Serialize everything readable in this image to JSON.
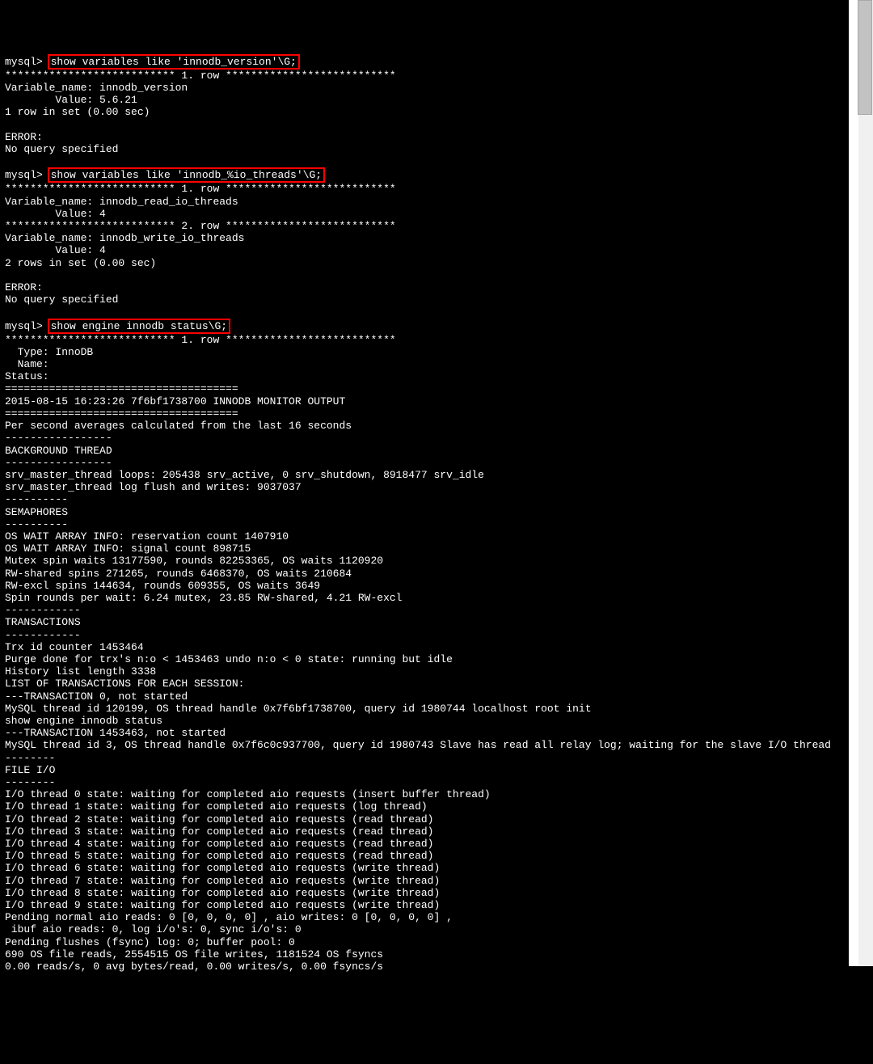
{
  "prompt": "mysql> ",
  "cmd1": "show variables like 'innodb_version'\\G;",
  "block1": "*************************** 1. row ***************************\nVariable_name: innodb_version\n        Value: 5.6.21\n1 row in set (0.00 sec)\n\nERROR:\nNo query specified\n",
  "cmd2": "show variables like 'innodb_%io_threads'\\G;",
  "block2": "*************************** 1. row ***************************\nVariable_name: innodb_read_io_threads\n        Value: 4\n*************************** 2. row ***************************\nVariable_name: innodb_write_io_threads\n        Value: 4\n2 rows in set (0.00 sec)\n\nERROR:\nNo query specified\n",
  "cmd3": "show engine innodb status\\G;",
  "block3": "*************************** 1. row ***************************\n  Type: InnoDB\n  Name:\nStatus:\n=====================================\n2015-08-15 16:23:26 7f6bf1738700 INNODB MONITOR OUTPUT\n=====================================\nPer second averages calculated from the last 16 seconds\n-----------------\nBACKGROUND THREAD\n-----------------\nsrv_master_thread loops: 205438 srv_active, 0 srv_shutdown, 8918477 srv_idle\nsrv_master_thread log flush and writes: 9037037\n----------\nSEMAPHORES\n----------\nOS WAIT ARRAY INFO: reservation count 1407910\nOS WAIT ARRAY INFO: signal count 898715\nMutex spin waits 13177590, rounds 82253365, OS waits 1120920\nRW-shared spins 271265, rounds 6468370, OS waits 210684\nRW-excl spins 144634, rounds 609355, OS waits 3649\nSpin rounds per wait: 6.24 mutex, 23.85 RW-shared, 4.21 RW-excl\n------------\nTRANSACTIONS\n------------\nTrx id counter 1453464\nPurge done for trx's n:o < 1453463 undo n:o < 0 state: running but idle\nHistory list length 3338\nLIST OF TRANSACTIONS FOR EACH SESSION:\n---TRANSACTION 0, not started\nMySQL thread id 120199, OS thread handle 0x7f6bf1738700, query id 1980744 localhost root init\nshow engine innodb status\n---TRANSACTION 1453463, not started\nMySQL thread id 3, OS thread handle 0x7f6c0c937700, query id 1980743 Slave has read all relay log; waiting for the slave I/O thread\n--------\nFILE I/O\n--------\nI/O thread 0 state: waiting for completed aio requests (insert buffer thread)\nI/O thread 1 state: waiting for completed aio requests (log thread)\nI/O thread 2 state: waiting for completed aio requests (read thread)\nI/O thread 3 state: waiting for completed aio requests (read thread)\nI/O thread 4 state: waiting for completed aio requests (read thread)\nI/O thread 5 state: waiting for completed aio requests (read thread)\nI/O thread 6 state: waiting for completed aio requests (write thread)\nI/O thread 7 state: waiting for completed aio requests (write thread)\nI/O thread 8 state: waiting for completed aio requests (write thread)\nI/O thread 9 state: waiting for completed aio requests (write thread)\nPending normal aio reads: 0 [0, 0, 0, 0] , aio writes: 0 [0, 0, 0, 0] ,\n ibuf aio reads: 0, log i/o's: 0, sync i/o's: 0\nPending flushes (fsync) log: 0; buffer pool: 0\n690 OS file reads, 2554515 OS file writes, 1181524 OS fsyncs\n0.00 reads/s, 0 avg bytes/read, 0.00 writes/s, 0.00 fsyncs/s"
}
